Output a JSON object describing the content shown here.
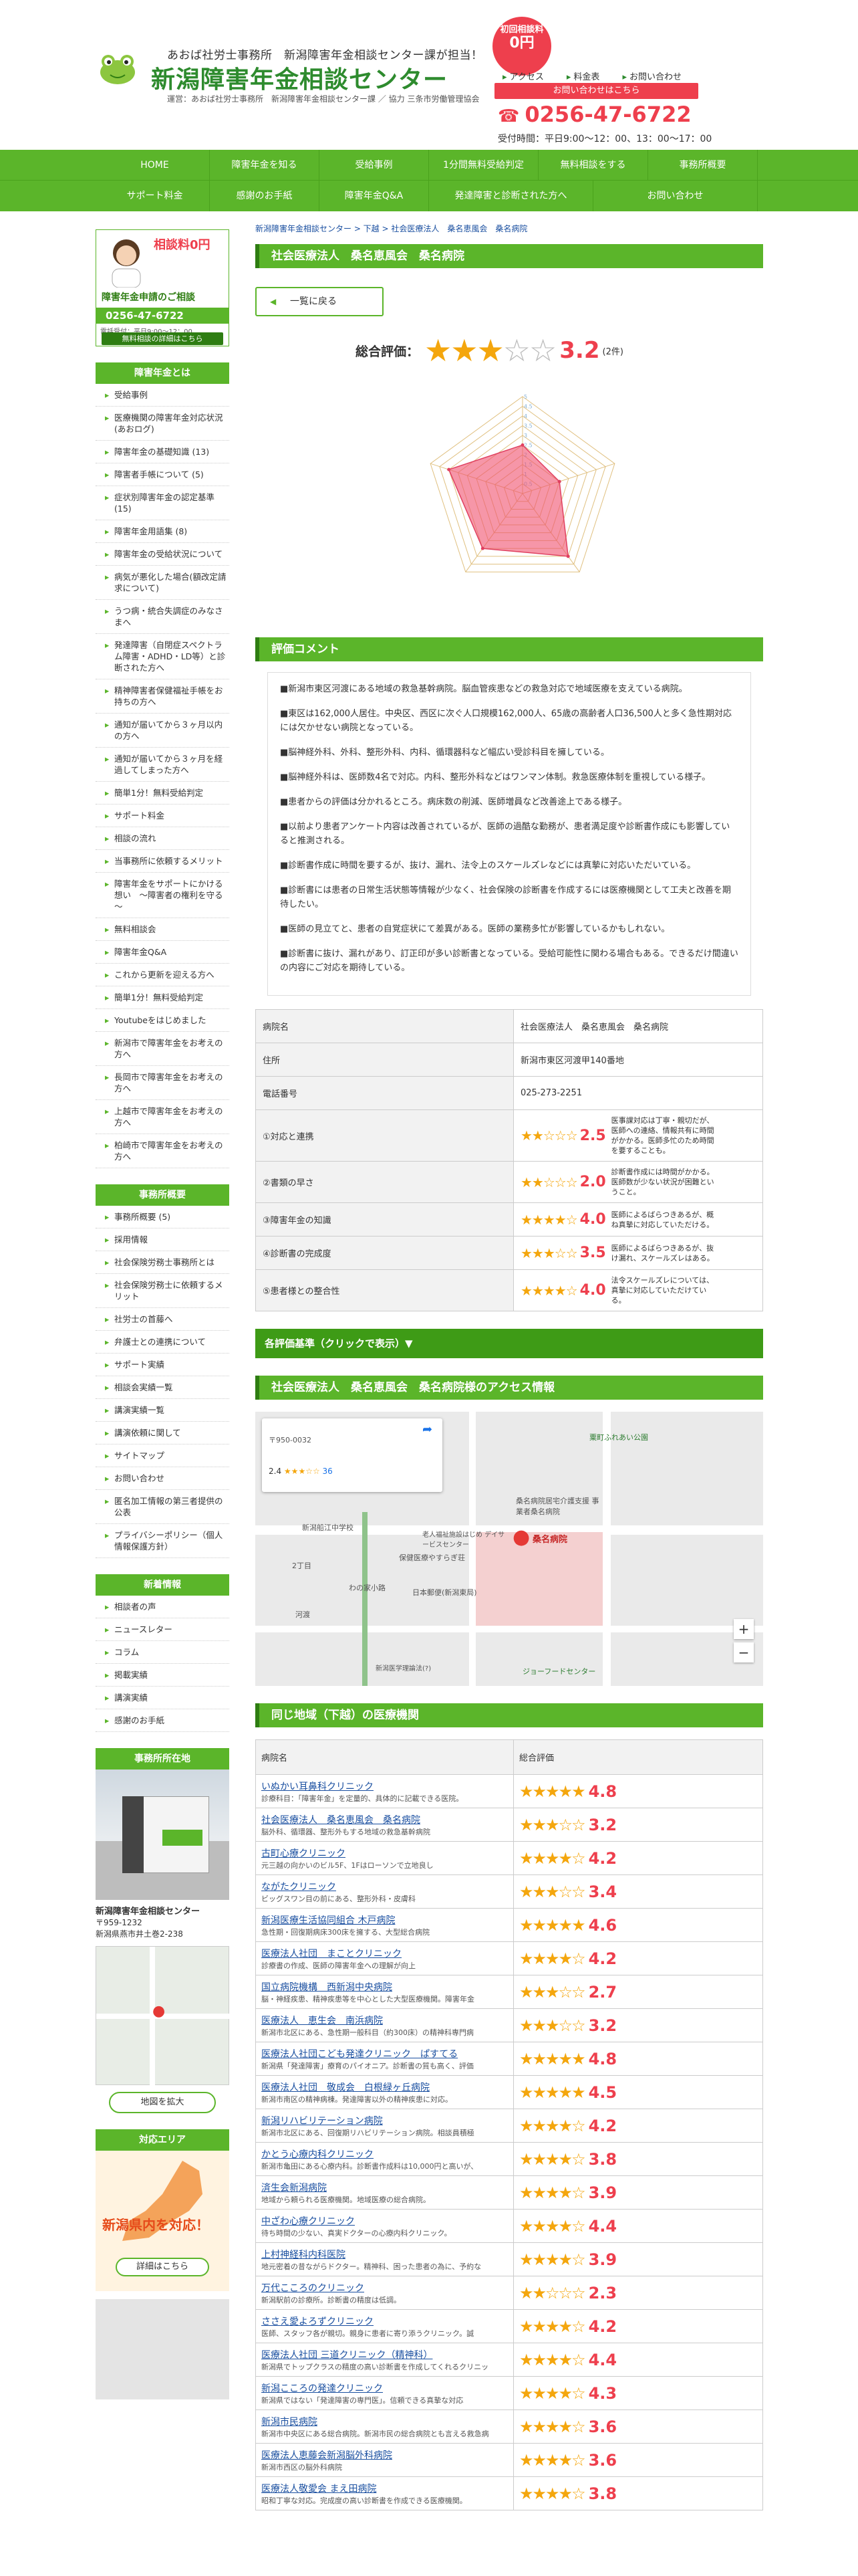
{
  "header": {
    "tagline": "あおば社労士事務所　新潟障害年金相談センター課が担当！",
    "title": "新潟障害年金相談センター",
    "operator": "運営：あおば社労士事務所　新潟障害年金相談センター課 ／ 協力 三条市労働管理協会",
    "badge_line1": "初回相談料",
    "badge_line2": "0円",
    "nav": [
      "アクセス",
      "料金表",
      "お問い合わせ"
    ],
    "inquiry_button": "お問い合わせはこちら",
    "phone": "0256-47-6722",
    "hours": "受付時間：平日9:00～12：00、13：00～17：00"
  },
  "global_nav": {
    "row1": [
      "HOME",
      "障害年金を知る",
      "受給事例",
      "1分間無料受給判定",
      "無料相談をする",
      "事務所概要"
    ],
    "row2": [
      "サポート料金",
      "感謝のお手紙",
      "障害年金Q&A",
      "発達障害と診断された方へ",
      "お問い合わせ"
    ]
  },
  "sidebar": {
    "card_title": "障害年金申請のご相談",
    "card_badge": "相談料0円",
    "card_phone": "0256-47-6722",
    "card_hours": "電話受付：平日9:00～12：00、",
    "card_button": "無料相談の詳細はこちら",
    "section1_title": "障害年金とは",
    "section1_items": [
      "受給事例",
      "医療機関の障害年金対応状況(あおログ)",
      "障害年金の基礎知識 (13)",
      "障害者手帳について (5)",
      "症状別障害年金の認定基準 (15)",
      "障害年金用語集 (8)",
      "障害年金の受給状況について",
      "病気が悪化した場合(額改定請求について)",
      "うつ病・統合失調症のみなさまへ",
      "発達障害（自閉症スペクトラム障害・ADHD・LD等）と診断された方へ",
      "精神障害者保健福祉手帳をお持ちの方へ",
      "通知が届いてから３ヶ月以内の方へ",
      "通知が届いてから３ヶ月を経過してしまった方へ",
      "簡単1分！無料受給判定",
      "サポート料金",
      "相談の流れ",
      "当事務所に依頼するメリット",
      "障害年金をサポートにかける想い　～障害者の権利を守る～",
      "無料相談会",
      "障害年金Q&A",
      "これから更新を迎える方へ",
      "簡単1分！無料受給判定",
      "Youtubeをはじめました",
      "新潟市で障害年金をお考えの方へ",
      "長岡市で障害年金をお考えの方へ",
      "上越市で障害年金をお考えの方へ",
      "柏崎市で障害年金をお考えの方へ"
    ],
    "section2_title": "事務所概要",
    "section2_items": [
      "事務所概要 (5)",
      "採用情報",
      "社会保険労務士事務所とは",
      "社会保険労務士に依頼するメリット",
      "社労士の首藤へ",
      "弁護士との連携について",
      "サポート実績",
      "相談会実績一覧",
      "講演実績一覧",
      "講演依頼に関して",
      "サイトマップ",
      "お問い合わせ",
      "匿名加工情報の第三者提供の公表",
      "プライバシーポリシー（個人情報保護方針）"
    ],
    "section3_title": "新着情報",
    "section3_items": [
      "相談者の声",
      "ニュースレター",
      "コラム",
      "掲載実績",
      "講演実績",
      "感謝のお手紙"
    ],
    "office_title": "事務所所在地",
    "office_name": "新潟障害年金相談センター",
    "office_zip": "〒959-1232",
    "office_addr": "新潟県燕市井土巻2-238",
    "map_button": "地図を拡大",
    "area_title": "対応エリア",
    "area_text": "新潟県内を対応！",
    "area_button": "詳細はこちら"
  },
  "main": {
    "breadcrumb": "新潟障害年金相談センター > 下越 > 社会医療法人　桑名恵風会　桑名病院",
    "title": "社会医療法人　桑名恵風会　桑名病院",
    "back_button": "一覧に戻る",
    "rating_label": "総合評価：",
    "rating_value": "3.2",
    "rating_count": "(2件)",
    "radar": {
      "axes": [
        "①対応と連携",
        "②書類の早さ",
        "③障害年金の知識",
        "④診断書の完成度",
        "⑤患者様との整合性"
      ],
      "values": [
        2.5,
        2.0,
        4.0,
        3.5,
        4.0
      ],
      "max": 5,
      "ticks": [
        "0.5",
        "1",
        "1.5",
        "2",
        "2.5",
        "3",
        "3.5",
        "4",
        "4.5",
        "5"
      ]
    },
    "comment_title": "評価コメント",
    "comments": [
      "■新潟市東区河渡にある地域の救急基幹病院。脳血管疾患などの救急対応で地域医療を支えている病院。",
      "■東区は162,000人居住。中央区、西区に次ぐ人口規模162,000人、65歳の高齢者人口36,500人と多く急性期対応には欠かせない病院となっている。",
      "■脳神経外科、外科、整形外科、内科、循環器科など幅広い受診科目を擁している。",
      "■脳神経外科は、医師数4名で対応。内科、整形外科などはワンマン体制。救急医療体制を重視している様子。",
      "■患者からの評価は分かれるところ。病床数の削減、医師増員など改善途上である様子。",
      "■以前より患者アンケート内容は改善されているが、医師の過酷な勤務が、患者満足度や診断書作成にも影響していると推測される。",
      "■診断書作成に時間を要するが、抜け、漏れ、法令上のスケールズレなどには真摯に対応いただいている。",
      "■診断書には患者の日常生活状態等情報が少なく、社会保険の診断書を作成するには医療機関として工夫と改善を期待したい。",
      "■医師の見立てと、患者の自覚症状にて差異がある。医師の業務多忙が影響しているかもしれない。",
      "■診断書に抜け、漏れがあり、訂正印が多い診断書となっている。受給可能性に関わる場合もある。できるだけ間違いの内容にご対応を期待している。"
    ],
    "info": {
      "name_label": "病院名",
      "name_value": "社会医療法人　桑名恵風会　桑名病院",
      "addr_label": "住所",
      "addr_value": "新潟市東区河渡甲140番地",
      "tel_label": "電話番号",
      "tel_value": "025-273-2251",
      "criteria": [
        {
          "label": "①対応と連携",
          "score": "2.5",
          "stars": "★★☆☆☆",
          "comment": "医事課対応は丁寧・親切だが、医師への連絡、情報共有に時間がかかる。医師多忙のため時間を要することも。"
        },
        {
          "label": "②書類の早さ",
          "score": "2.0",
          "stars": "★★☆☆☆",
          "comment": "診断書作成には時間がかかる。医師数が少ない状況が困難ということ。"
        },
        {
          "label": "③障害年金の知識",
          "score": "4.0",
          "stars": "★★★★☆",
          "comment": "医師によるばらつきあるが、概ね真摯に対応していただける。"
        },
        {
          "label": "④診断書の完成度",
          "score": "3.5",
          "stars": "★★★☆☆",
          "comment": "医師によるばらつきあるが、抜け漏れ、スケールズレはある。"
        },
        {
          "label": "⑤患者様との整合性",
          "score": "4.0",
          "stars": "★★★★☆",
          "comment": "法令スケールズレについては、真摯に対応していただけている。"
        }
      ]
    },
    "toggle_bar": "各評価基準（クリックで表示）▼",
    "access_title": "社会医療法人　桑名恵風会　桑名病院様のアクセス情報",
    "map": {
      "hospital_label": "桑名病院",
      "card_zip": "〒950-0032",
      "card_rating": "2.4",
      "card_count": "36",
      "labels": [
        "新潟船江中学校",
        "桑名病院居宅介護支援 事業者桑名病院",
        "老人福祉施設はじめ デイサービスセンター",
        "日本郵便(新潟東局)",
        "保健医療やすらぎ荘",
        "2丁目",
        "河渡",
        "新潟医学理論法(?)",
        "ジョーフードセンター",
        "粟町ふれあい公園",
        "ゆうの家小路",
        "わの家小路"
      ]
    },
    "related_title": "同じ地域（下越）の医療機関",
    "related_col1": "病院名",
    "related_col2": "総合評価",
    "related": [
      {
        "name": "いぬかい耳鼻科クリニック",
        "desc": "診療科目：「障害年金」を定量的、具体的に記載できる医院。",
        "stars": "★★★★★",
        "score": "4.8"
      },
      {
        "name": "社会医療法人　桑名恵風会　桑名病院",
        "desc": "脳外科、循環器、整形外もする地域の救急基幹病院",
        "stars": "★★★☆☆",
        "score": "3.2"
      },
      {
        "name": "古町心療クリニック",
        "desc": "元三越の向かいのビル5F、1Fはローソンで立地良し",
        "stars": "★★★★☆",
        "score": "4.2"
      },
      {
        "name": "ながたクリニック",
        "desc": "ビッグスワン目の前にある、整形外科・皮膚科",
        "stars": "★★★☆☆",
        "score": "3.4"
      },
      {
        "name": "新潟医療生活協同組合 木戸病院",
        "desc": "急性期・回復期病床300床を擁する、大型総合病院",
        "stars": "★★★★★",
        "score": "4.6"
      },
      {
        "name": "医療法人社団　まことクリニック",
        "desc": "診療書の作成、医師の障害年金への理解が向上",
        "stars": "★★★★☆",
        "score": "4.2"
      },
      {
        "name": "国立病院機構　西新潟中央病院",
        "desc": "脳・神経疾患、精神疾患等を中心とした大型医療機関。障害年金",
        "stars": "★★★☆☆",
        "score": "2.7"
      },
      {
        "name": "医療法人　恵生会　南浜病院",
        "desc": "新潟市北区にある、急性期一般科目（約300床）の精神科専門病",
        "stars": "★★★☆☆",
        "score": "3.2"
      },
      {
        "name": "医療法人社団こども発達クリニック　ぱすてる",
        "desc": "新潟県「発達障害」療育のパイオニア。診断書の質も高く、評価",
        "stars": "★★★★★",
        "score": "4.8"
      },
      {
        "name": "医療法人社団　敬成会　白根緑ヶ丘病院",
        "desc": "新潟市南区の精神病棟。発達障害以外の精神疾患に対応。",
        "stars": "★★★★★",
        "score": "4.5"
      },
      {
        "name": "新潟リハビリテーション病院",
        "desc": "新潟市北区にある、回復期リハビリテーション病院。相談員積極",
        "stars": "★★★★☆",
        "score": "4.2"
      },
      {
        "name": "かとう心療内科クリニック",
        "desc": "新潟市亀田にある心療内科。診断書作成料は10,000円と高いが、",
        "stars": "★★★★☆",
        "score": "3.8"
      },
      {
        "name": "済生会新潟病院",
        "desc": "地域から頼られる医療機関。地域医療の総合病院。",
        "stars": "★★★★☆",
        "score": "3.9"
      },
      {
        "name": "中ざわ心療クリニック",
        "desc": "待ち時間の少ない、真実ドクターの心療内科クリニック。",
        "stars": "★★★★☆",
        "score": "4.4"
      },
      {
        "name": "上村神経科内科医院",
        "desc": "地元密着の昔ながらドクター。精神科、困った患者の為に、予約な",
        "stars": "★★★★☆",
        "score": "3.9"
      },
      {
        "name": "万代こころのクリニック",
        "desc": "新潟駅前の診療所。診断書の精度は低調。",
        "stars": "★★☆☆☆",
        "score": "2.3"
      },
      {
        "name": "ささえ愛よろずクリニック",
        "desc": "医師、スタッフ各が親切。親身に患者に寄り添うクリニック。誠",
        "stars": "★★★★☆",
        "score": "4.2"
      },
      {
        "name": "医療法人社団 三道クリニック（精神科）",
        "desc": "新潟県でトップクラスの精度の高い診断書を作成してくれるクリニッ",
        "stars": "★★★★☆",
        "score": "4.4"
      },
      {
        "name": "新潟こころの発達クリニック",
        "desc": "新潟県ではない「発達障害の専門医」。信頼できる真摯な対応",
        "stars": "★★★★☆",
        "score": "4.3"
      },
      {
        "name": "新潟市民病院",
        "desc": "新潟市中央区にある総合病院。新潟市民の総合病院とも言える救急病",
        "stars": "★★★★☆",
        "score": "3.6"
      },
      {
        "name": "医療法人恵藤会新潟脳外科病院",
        "desc": "新潟市西区の脳外科病院",
        "stars": "★★★★☆",
        "score": "3.6"
      },
      {
        "name": "医療法人敬愛会 まえ田病院",
        "desc": "昭和丁寧な対応。完成度の高い診断書を作成できる医療機関。",
        "stars": "★★★★☆",
        "score": "3.8"
      }
    ]
  },
  "colors": {
    "green": "#5bb52a",
    "dark_green": "#2e7d12",
    "red": "#ee3f4d",
    "star": "#f4a60d"
  }
}
